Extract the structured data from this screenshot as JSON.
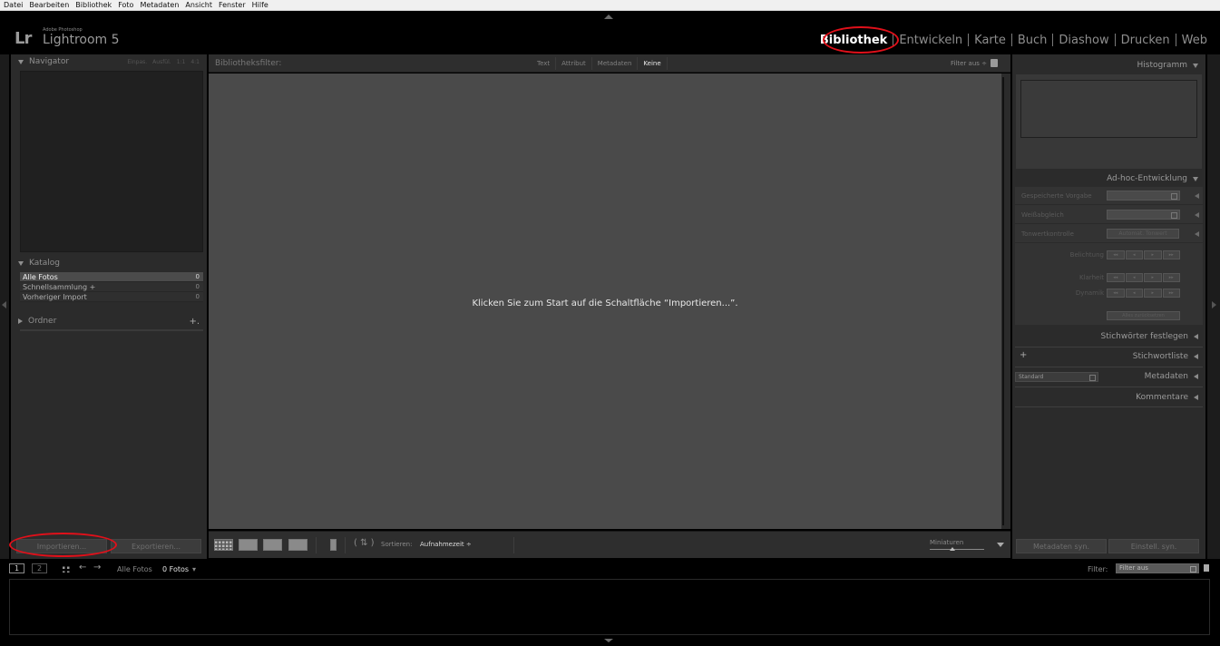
{
  "menu": [
    "Datei",
    "Bearbeiten",
    "Bibliothek",
    "Foto",
    "Metadaten",
    "Ansicht",
    "Fenster",
    "Hilfe"
  ],
  "logo": {
    "mark": "Lr",
    "small": "Adobe Photoshop",
    "title": "Lightroom 5"
  },
  "modules": [
    "Bibliothek",
    "Entwickeln",
    "Karte",
    "Buch",
    "Diashow",
    "Drucken",
    "Web"
  ],
  "active_module": "Bibliothek",
  "highlight_color": "#e0101a",
  "left": {
    "navigator": {
      "title": "Navigator",
      "options": [
        "Einpas.",
        "Ausfül.",
        "1:1",
        "4:1"
      ]
    },
    "katalog": {
      "title": "Katalog",
      "items": [
        {
          "label": "Alle Fotos",
          "count": "0"
        },
        {
          "label": "Schnellsammlung +",
          "count": "0"
        },
        {
          "label": "Vorheriger Import",
          "count": "0"
        }
      ]
    },
    "ordner": {
      "title": "Ordner",
      "plus": "+."
    },
    "import_label": "Importieren...",
    "export_label": "Exportieren..."
  },
  "center": {
    "filter_title": "Bibliotheksfilter:",
    "filter_tabs": [
      "Text",
      "Attribut",
      "Metadaten",
      "Keine"
    ],
    "filter_active": "Keine",
    "filter_off": "Filter aus ÷",
    "message": "Klicken Sie zum Start auf die Schaltfläche “Importieren...”.",
    "toolbar": {
      "sort_label": "Sortieren:",
      "sort_value": "Aufnahmezeit ÷",
      "thumb_label": "Miniaturen"
    }
  },
  "right": {
    "histogram": "Histogramm",
    "adhoc": {
      "title": "Ad-hoc-Entwicklung",
      "saved_preset": "Gespeicherte Vorgabe",
      "white_balance": "Weißabgleich",
      "tone_control": "Tonwertkontrolle",
      "auto_tone": "Automat. Tonwert",
      "exposure": "Belichtung",
      "clarity": "Klarheit",
      "vibrance": "Dynamik",
      "reset_all": "Alles zurücksetzen",
      "stepper": [
        "◂◂",
        "◂",
        "▸",
        "▸▸"
      ]
    },
    "panels": [
      "Stichwörter festlegen",
      "Stichwortliste",
      "Metadaten",
      "Kommentare"
    ],
    "metadata_preset": "Standard",
    "sync_metadata": "Metadaten syn.",
    "sync_settings": "Einstell. syn."
  },
  "filmstrip": {
    "pages": [
      "1",
      "2"
    ],
    "source": "Alle Fotos",
    "count": "0 Fotos",
    "filter_label": "Filter:",
    "filter_value": "Filter aus"
  }
}
